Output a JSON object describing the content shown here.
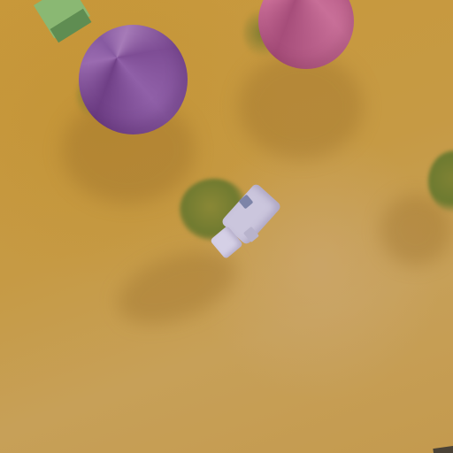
{
  "scene": {
    "colors": {
      "ground": "#c69a44",
      "purple_cone": "#8e5a9e",
      "pink_cone": "#c4668f",
      "green_block": "#7faa6a",
      "animal": "#c9c4dc",
      "bush": "#7a7a30"
    },
    "objects": [
      {
        "kind": "cone",
        "color": "purple"
      },
      {
        "kind": "cone",
        "color": "pink"
      },
      {
        "kind": "block",
        "color": "green"
      },
      {
        "kind": "animal",
        "color": "lavender"
      },
      {
        "kind": "bush",
        "color": "olive"
      }
    ]
  }
}
